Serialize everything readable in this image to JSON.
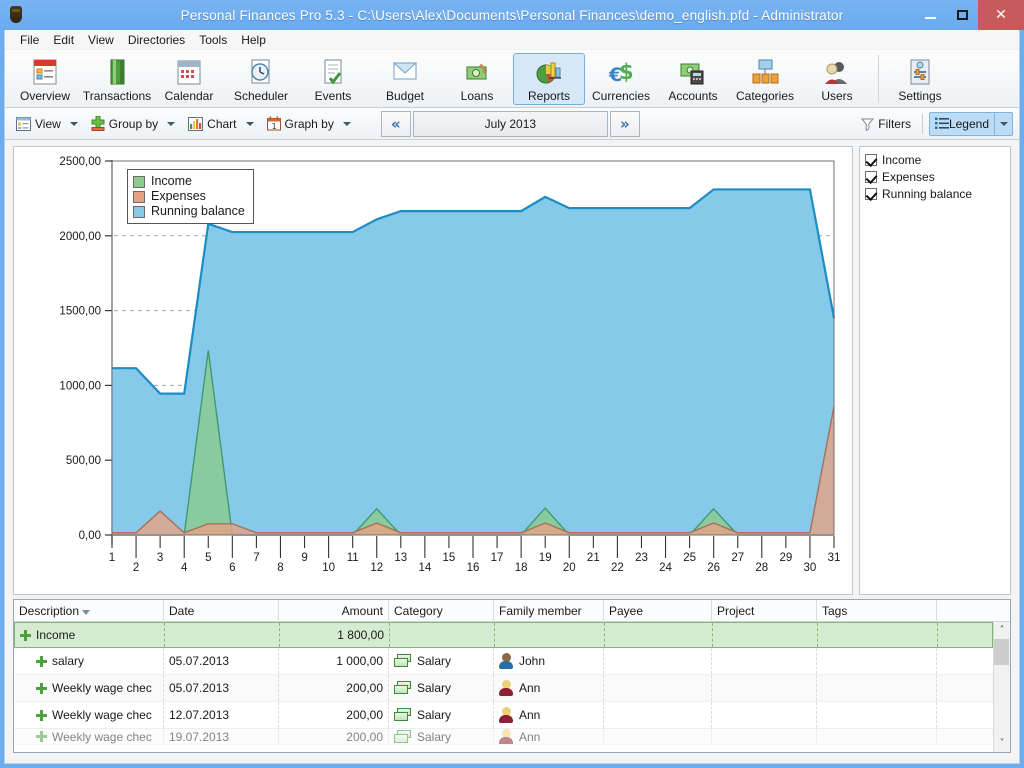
{
  "window": {
    "title": "Personal Finances Pro 5.3 - C:\\Users\\Alex\\Documents\\Personal Finances\\demo_english.pfd - Administrator",
    "minimize_label": "–",
    "maximize_label": "□",
    "close_label": "✕",
    "accent": "#6aaaef",
    "close_color": "#c75b5b"
  },
  "menubar": {
    "items": [
      {
        "label": "File"
      },
      {
        "label": "Edit"
      },
      {
        "label": "View"
      },
      {
        "label": "Directories"
      },
      {
        "label": "Tools"
      },
      {
        "label": "Help"
      }
    ]
  },
  "ribbon": {
    "items": [
      {
        "label": "Overview",
        "icon": "overview-icon",
        "active": false
      },
      {
        "label": "Transactions",
        "icon": "transactions-icon",
        "active": false
      },
      {
        "label": "Calendar",
        "icon": "calendar-icon",
        "active": false
      },
      {
        "label": "Scheduler",
        "icon": "scheduler-icon",
        "active": false
      },
      {
        "label": "Events",
        "icon": "events-icon",
        "active": false
      },
      {
        "label": "Budget",
        "icon": "budget-icon",
        "active": false
      },
      {
        "label": "Loans",
        "icon": "loans-icon",
        "active": false
      },
      {
        "label": "Reports",
        "icon": "reports-icon",
        "active": true
      },
      {
        "label": "Currencies",
        "icon": "currencies-icon",
        "active": false
      },
      {
        "label": "Accounts",
        "icon": "accounts-icon",
        "active": false
      },
      {
        "label": "Categories",
        "icon": "categories-icon",
        "active": false
      },
      {
        "label": "Users",
        "icon": "users-icon",
        "active": false
      },
      {
        "label": "Settings",
        "icon": "settings-icon",
        "active": false
      }
    ]
  },
  "toolbar": {
    "view_label": "View",
    "group_by_label": "Group by",
    "chart_label": "Chart",
    "graph_by_label": "Graph by",
    "prev_label": "«",
    "next_label": "»",
    "period_value": "July 2013",
    "filters_label": "Filters",
    "legend_label": "Legend"
  },
  "legend_panel": {
    "items": [
      {
        "label": "Income",
        "checked": true
      },
      {
        "label": "Expenses",
        "checked": true
      },
      {
        "label": "Running balance",
        "checked": true
      }
    ]
  },
  "chart_data": {
    "type": "area",
    "title": "",
    "xlabel": "",
    "ylabel": "",
    "ylim": [
      0,
      2500
    ],
    "yticks": [
      0,
      500,
      1000,
      1500,
      2000,
      2500
    ],
    "ytick_labels": [
      "0,00",
      "500,00",
      "1000,00",
      "1500,00",
      "2000,00",
      "2500,00"
    ],
    "grid": true,
    "legend_position": "inside-top-left",
    "x": [
      1,
      2,
      3,
      4,
      5,
      6,
      7,
      8,
      9,
      10,
      11,
      12,
      13,
      14,
      15,
      16,
      17,
      18,
      19,
      20,
      21,
      22,
      23,
      24,
      25,
      26,
      27,
      28,
      29,
      30,
      31
    ],
    "xtick_labels": [
      "1",
      "2",
      "3",
      "4",
      "5",
      "6",
      "7",
      "8",
      "9",
      "10",
      "11",
      "12",
      "13",
      "14",
      "15",
      "16",
      "17",
      "18",
      "19",
      "20",
      "21",
      "22",
      "23",
      "24",
      "25",
      "26",
      "27",
      "28",
      "29",
      "30",
      "31"
    ],
    "series": [
      {
        "name": "Income",
        "color": "#8ccb8a",
        "line_color": "#3f9a6f",
        "values": [
          0,
          0,
          0,
          0,
          1235,
          0,
          0,
          0,
          0,
          0,
          0,
          175,
          0,
          0,
          0,
          0,
          0,
          0,
          180,
          0,
          0,
          0,
          0,
          0,
          0,
          175,
          0,
          0,
          0,
          0,
          0
        ]
      },
      {
        "name": "Expenses",
        "color": "#e8a183",
        "line_color": "#a8705a",
        "values": [
          15,
          15,
          160,
          15,
          75,
          75,
          15,
          15,
          15,
          15,
          15,
          80,
          15,
          15,
          15,
          15,
          15,
          15,
          80,
          15,
          15,
          15,
          15,
          15,
          15,
          80,
          15,
          15,
          15,
          15,
          860
        ]
      },
      {
        "name": "Running balance",
        "color": "#86c9e8",
        "line_color": "#1b8cc4",
        "values": [
          1115,
          1115,
          945,
          945,
          2080,
          2025,
          2025,
          2025,
          2025,
          2025,
          2025,
          2110,
          2165,
          2165,
          2165,
          2165,
          2165,
          2165,
          2260,
          2185,
          2185,
          2185,
          2185,
          2185,
          2185,
          2310,
          2310,
          2310,
          2310,
          2310,
          1450
        ]
      }
    ]
  },
  "grid": {
    "columns": [
      {
        "key": "description",
        "label": "Description",
        "width": 150,
        "align": "left",
        "sorted": true
      },
      {
        "key": "date",
        "label": "Date",
        "width": 115,
        "align": "left",
        "sorted": false
      },
      {
        "key": "amount",
        "label": "Amount",
        "width": 110,
        "align": "right",
        "sorted": false
      },
      {
        "key": "category",
        "label": "Category",
        "width": 105,
        "align": "left",
        "sorted": false
      },
      {
        "key": "family_member",
        "label": "Family member",
        "width": 110,
        "align": "left",
        "sorted": false
      },
      {
        "key": "payee",
        "label": "Payee",
        "width": 108,
        "align": "left",
        "sorted": false
      },
      {
        "key": "project",
        "label": "Project",
        "width": 105,
        "align": "left",
        "sorted": false
      },
      {
        "key": "tags",
        "label": "Tags",
        "width": 120,
        "align": "left",
        "sorted": false
      }
    ],
    "rows": [
      {
        "type": "group",
        "description": "Income",
        "date": "",
        "amount": "1 800,00",
        "category": "",
        "family_member": "",
        "payee": "",
        "project": "",
        "tags": ""
      },
      {
        "type": "item",
        "description": "salary",
        "date": "05.07.2013",
        "amount": "1 000,00",
        "category": "Salary",
        "family_member": "John",
        "member_hair": "#8a6a46",
        "member_shirt": "#2a6ea8",
        "payee": "",
        "project": "",
        "tags": ""
      },
      {
        "type": "item",
        "description": "Weekly wage chec",
        "date": "05.07.2013",
        "amount": "200,00",
        "category": "Salary",
        "family_member": "Ann",
        "member_hair": "#e8d27a",
        "member_shirt": "#8e2030",
        "payee": "",
        "project": "",
        "tags": ""
      },
      {
        "type": "item",
        "description": "Weekly wage chec",
        "date": "12.07.2013",
        "amount": "200,00",
        "category": "Salary",
        "family_member": "Ann",
        "member_hair": "#e8d27a",
        "member_shirt": "#8e2030",
        "payee": "",
        "project": "",
        "tags": ""
      },
      {
        "type": "item-cut",
        "description": "Weekly wage chec",
        "date": "19.07.2013",
        "amount": "200,00",
        "category": "Salary",
        "family_member": "Ann",
        "member_hair": "#e8d27a",
        "member_shirt": "#8e2030",
        "payee": "",
        "project": "",
        "tags": ""
      }
    ],
    "scrollbar": {
      "up_label": "˄",
      "down_label": "˅"
    }
  }
}
